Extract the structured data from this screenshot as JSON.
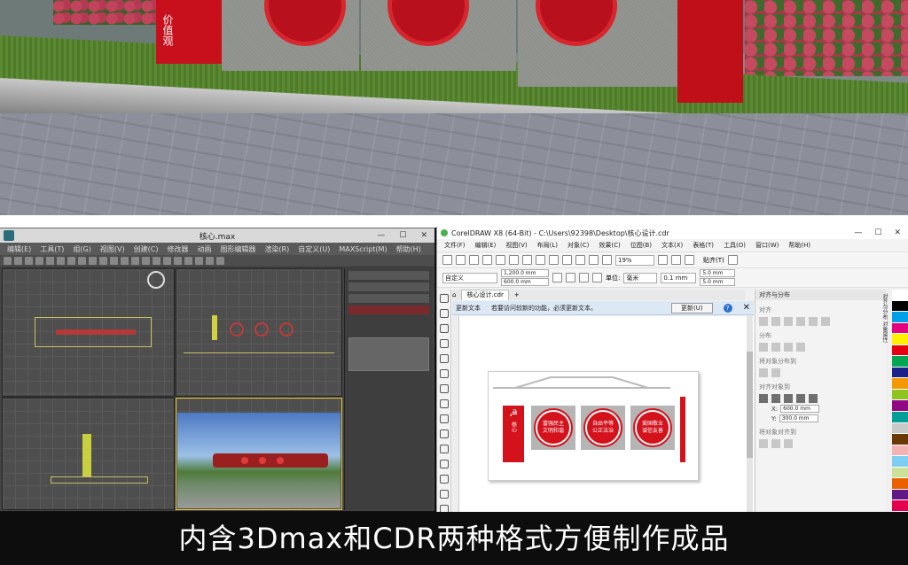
{
  "render": {
    "pole_text": "价值观"
  },
  "max_window": {
    "title": "核心.max",
    "menu": [
      "编辑(E)",
      "工具(T)",
      "组(G)",
      "视图(V)",
      "创建(C)",
      "修改器",
      "动画",
      "图形编辑器",
      "渲染(R)",
      "自定义(U)",
      "MAXScript(M)",
      "帮助(H)"
    ],
    "min_label": "—",
    "max_label": "☐",
    "close_label": "✕"
  },
  "cdr_window": {
    "title": "CorelDRAW X8 (64-Bit) - C:\\Users\\92398\\Desktop\\核心设计.cdr",
    "menu": [
      "文件(F)",
      "编辑(E)",
      "视图(V)",
      "布局(L)",
      "对象(C)",
      "效果(C)",
      "位图(B)",
      "文本(X)",
      "表格(T)",
      "工具(O)",
      "窗口(W)",
      "帮助(H)"
    ],
    "min_label": "—",
    "max_label": "☐",
    "close_label": "✕",
    "zoom": "19%",
    "snap_label": "贴齐(T)",
    "preset": "自定义",
    "width": "1,200.0 mm",
    "height": "600.0 mm",
    "units_label": "单位:",
    "units": "毫米",
    "nudge": "0.1 mm",
    "dup_x": "5.0 mm",
    "dup_y": "5.0 mm",
    "doc_tab": "核心设计.cdr",
    "notify_title": "更新文本",
    "notify_text": "若要访问较新的功能，必须更新文本。",
    "update_button": "更新(U)",
    "help_label": "?",
    "notify_close": "✕",
    "dock_title": "对齐与分布",
    "dock_align": "对齐",
    "dock_distribute": "分布",
    "dock_spacing": "将对象分布到",
    "dock_position": "对齐对象到",
    "coord_x": "600.0 mm",
    "coord_y": "300.0 mm",
    "dock_text_group": "将对象对齐到",
    "vtab1": "对齐与分布",
    "vtab2": "对象属性",
    "art": {
      "party_label": "核心",
      "c1": "富强民主 文明和谐",
      "c2": "自由平等 公正法治",
      "c3": "爱国敬业 诚信友善"
    },
    "palette": [
      "#ffffff",
      "#000000",
      "#00a0e9",
      "#e4007f",
      "#fff100",
      "#e60012",
      "#00a650",
      "#1d2088",
      "#f39800",
      "#8fc31f",
      "#920783",
      "#009e96",
      "#c9c9c9",
      "#6a3906",
      "#f5b2b2",
      "#7ecef4",
      "#cce198",
      "#eb6100",
      "#601986",
      "#e5004f"
    ]
  },
  "caption": "内含3Dmax和CDR两种格式方便制作成品"
}
